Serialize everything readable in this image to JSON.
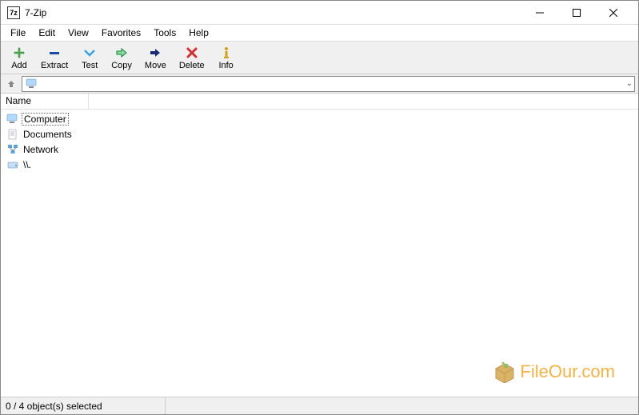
{
  "window": {
    "title": "7-Zip"
  },
  "menubar": {
    "items": [
      "File",
      "Edit",
      "View",
      "Favorites",
      "Tools",
      "Help"
    ]
  },
  "toolbar": {
    "items": [
      {
        "label": "Add",
        "icon": "plus",
        "color": "#4caf50"
      },
      {
        "label": "Extract",
        "icon": "minus",
        "color": "#1a4aa8"
      },
      {
        "label": "Test",
        "icon": "check-down",
        "color": "#3aa5dd"
      },
      {
        "label": "Copy",
        "icon": "arrow-right-outline",
        "color": "#0a8a3a"
      },
      {
        "label": "Move",
        "icon": "arrow-right",
        "color": "#1a2a7a"
      },
      {
        "label": "Delete",
        "icon": "x",
        "color": "#d32f2f"
      },
      {
        "label": "Info",
        "icon": "info",
        "color": "#d4a017"
      }
    ]
  },
  "address": {
    "path": ""
  },
  "columns": {
    "name": "Name"
  },
  "files": [
    {
      "name": "Computer",
      "icon": "computer",
      "selected": true
    },
    {
      "name": "Documents",
      "icon": "document",
      "selected": false
    },
    {
      "name": "Network",
      "icon": "network",
      "selected": false
    },
    {
      "name": "\\\\.",
      "icon": "drive",
      "selected": false
    }
  ],
  "statusbar": {
    "text": "0 / 4 object(s) selected"
  },
  "watermark": {
    "text": "FileOur.com"
  }
}
